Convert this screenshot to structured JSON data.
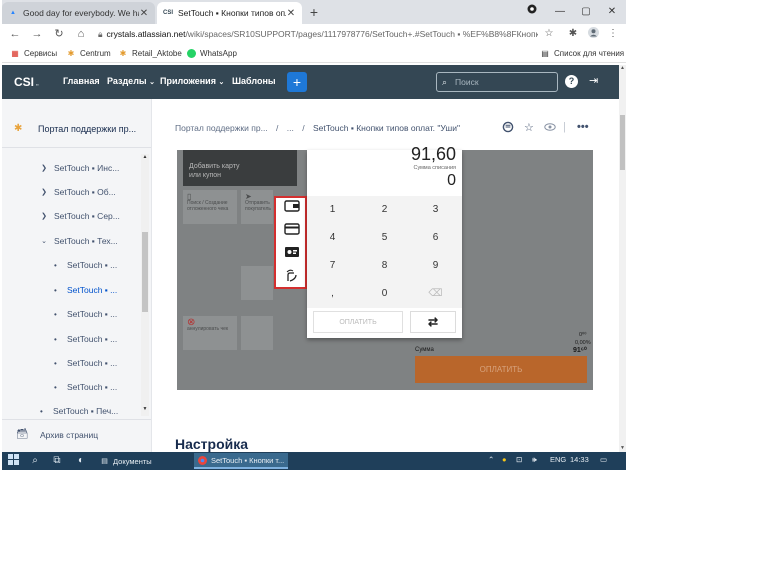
{
  "browser": {
    "tabs": [
      {
        "title": "Good day for everybody. We ha",
        "icon": "atlassian-icon"
      },
      {
        "title": "SetTouch ▪ Кнопки типов оплат",
        "icon": "csi-icon"
      }
    ],
    "url_host": "crystals.atlassian.net",
    "url_path": "/wiki/spaces/SR10SUPPORT/pages/1117978776/SetTouch+.#SetTouch ▪ %EF%B8%8FКнопк...",
    "bookmarks": [
      {
        "label": "Сервисы"
      },
      {
        "label": "Centrum"
      },
      {
        "label": "Retail_Aktobe"
      },
      {
        "label": "WhatsApp"
      }
    ],
    "reading_list": "Список для чтения"
  },
  "header": {
    "logo": "CSI",
    "nav": [
      "Главная",
      "Разделы",
      "Приложения",
      "Шаблоны"
    ],
    "create": "+",
    "search_placeholder": "Поиск",
    "help": "?"
  },
  "sidebar": {
    "space_title": "Портал поддержки пр...",
    "tree": [
      {
        "label": "SetTouch ▪ Инс...",
        "type": "collapsed"
      },
      {
        "label": "SetTouch ▪ Об...",
        "type": "collapsed"
      },
      {
        "label": "SetTouch ▪ Сер...",
        "type": "collapsed"
      },
      {
        "label": "SetTouch ▪ Тех...",
        "type": "expanded"
      },
      {
        "label": "SetTouch ▪ ...",
        "type": "leaf"
      },
      {
        "label": "SetTouch ▪ ...",
        "type": "leaf-active"
      },
      {
        "label": "SetTouch ▪ ...",
        "type": "leaf"
      },
      {
        "label": "SetTouch ▪ ...",
        "type": "leaf"
      },
      {
        "label": "SetTouch ▪ ...",
        "type": "leaf"
      },
      {
        "label": "SetTouch ▪ ...",
        "type": "leaf"
      },
      {
        "label": "SetTouch ▪ Печ...",
        "type": "leaf"
      }
    ],
    "archive": "Архив страниц"
  },
  "breadcrumb": {
    "root": "Портал поддержки пр...",
    "sep": "/",
    "ellipsis": "...",
    "current": "SetTouch ▪ Кнопки типов оплат. \"Уши\""
  },
  "screenshot": {
    "card_text_line1": "Добавить карту",
    "card_text_line2": "или купон",
    "tile1_text": "Поиск / Создание отложенного чека",
    "tile2_text": "Отправить покупатель",
    "tile3_text": "аннулировать чек",
    "total": "91,60",
    "sub_label": "Сумма списания",
    "entry": "0",
    "keys": [
      "1",
      "2",
      "3",
      "4",
      "5",
      "6",
      "7",
      "8",
      "9",
      ",",
      "0",
      "⌫"
    ],
    "pay_disabled": "ОПЛАТИТЬ",
    "swap": "⇄",
    "right_small1": "0⁰⁰",
    "right_small2": "0,00%",
    "sum_label": "Сумма",
    "sum_value": "91⁶⁰",
    "pay_button": "ОПЛАТИТЬ"
  },
  "content": {
    "section_title": "Настройка"
  },
  "taskbar": {
    "apps": [
      {
        "label": "Документы"
      },
      {
        "label": "SetTouch ▪ Кнопки т..."
      }
    ],
    "lang": "ENG",
    "time": "14:33"
  }
}
